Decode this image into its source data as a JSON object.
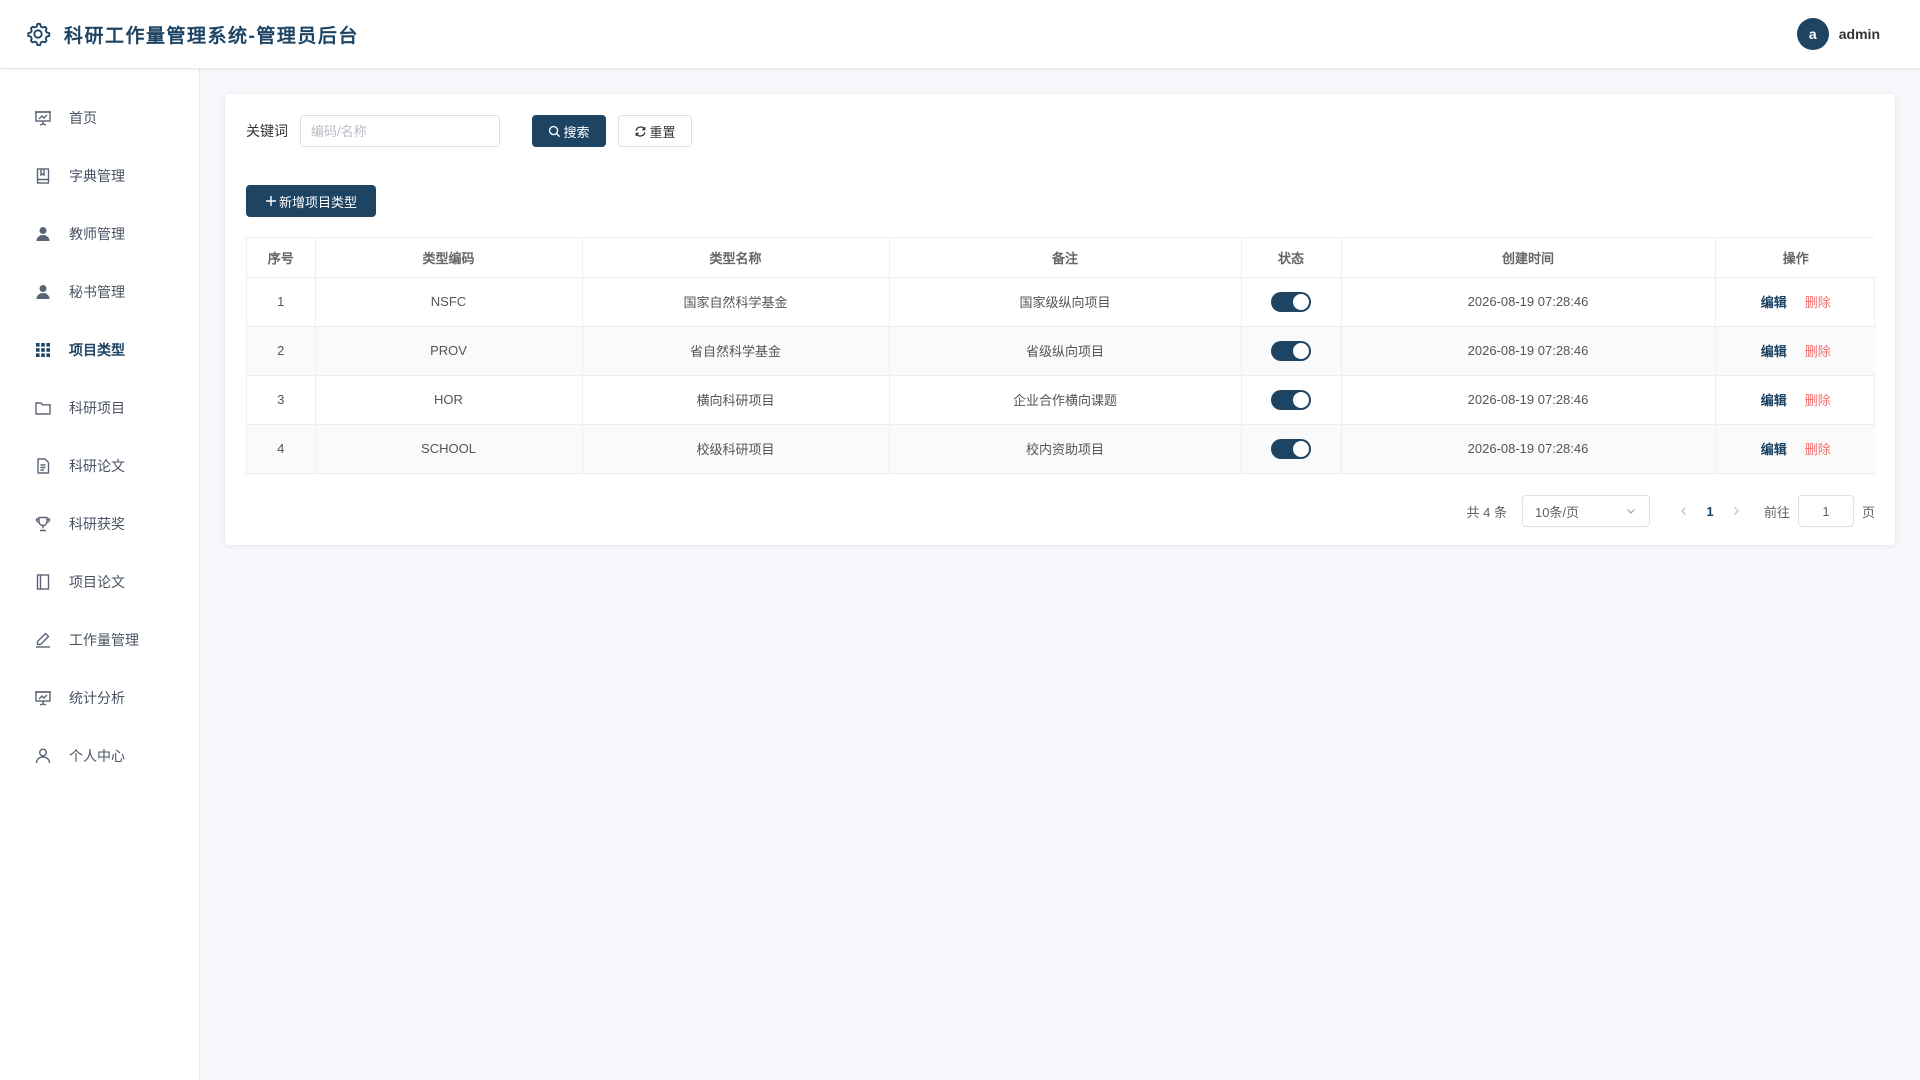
{
  "header": {
    "title": "科研工作量管理系统-管理员后台",
    "logo_icon": "gear-icon",
    "avatar_letter": "a",
    "username": "admin"
  },
  "sidebar": {
    "items": [
      {
        "label": "首页",
        "icon": "presentation-chart-icon"
      },
      {
        "label": "字典管理",
        "icon": "book-icon"
      },
      {
        "label": "教师管理",
        "icon": "user-filled-icon"
      },
      {
        "label": "秘书管理",
        "icon": "user-filled-icon"
      },
      {
        "label": "项目类型",
        "icon": "grid-icon",
        "active": true
      },
      {
        "label": "科研项目",
        "icon": "folder-icon"
      },
      {
        "label": "科研论文",
        "icon": "document-icon"
      },
      {
        "label": "科研获奖",
        "icon": "trophy-icon"
      },
      {
        "label": "项目论文",
        "icon": "notebook-icon"
      },
      {
        "label": "工作量管理",
        "icon": "edit-pen-icon"
      },
      {
        "label": "统计分析",
        "icon": "presentation-chart-icon"
      },
      {
        "label": "个人中心",
        "icon": "user-outline-icon"
      }
    ]
  },
  "search": {
    "keyword_label": "关键词",
    "placeholder": "编码/名称",
    "value": "",
    "search_label": "搜索",
    "reset_label": "重置"
  },
  "toolbar": {
    "add_label": "新增项目类型"
  },
  "table": {
    "columns": [
      "序号",
      "类型编码",
      "类型名称",
      "备注",
      "状态",
      "创建时间",
      "操作"
    ],
    "rows": [
      {
        "index": "1",
        "code": "NSFC",
        "name": "国家自然科学基金",
        "remark": "国家级纵向项目",
        "enabled": true,
        "created": "2026-08-19 07:28:46"
      },
      {
        "index": "2",
        "code": "PROV",
        "name": "省自然科学基金",
        "remark": "省级纵向项目",
        "enabled": true,
        "created": "2026-08-19 07:28:46"
      },
      {
        "index": "3",
        "code": "HOR",
        "name": "横向科研项目",
        "remark": "企业合作横向课题",
        "enabled": true,
        "created": "2026-08-19 07:28:46"
      },
      {
        "index": "4",
        "code": "SCHOOL",
        "name": "校级科研项目",
        "remark": "校内资助项目",
        "enabled": true,
        "created": "2026-08-19 07:28:46"
      }
    ],
    "edit_label": "编辑",
    "delete_label": "删除"
  },
  "pagination": {
    "total_text": "共 4 条",
    "page_size": "10条/页",
    "current_page": "1",
    "goto_label": "前往",
    "goto_value": "1",
    "page_suffix": "页"
  },
  "colors": {
    "primary": "#1e4463",
    "danger": "#f56c6c",
    "background": "#f5f7fa"
  }
}
